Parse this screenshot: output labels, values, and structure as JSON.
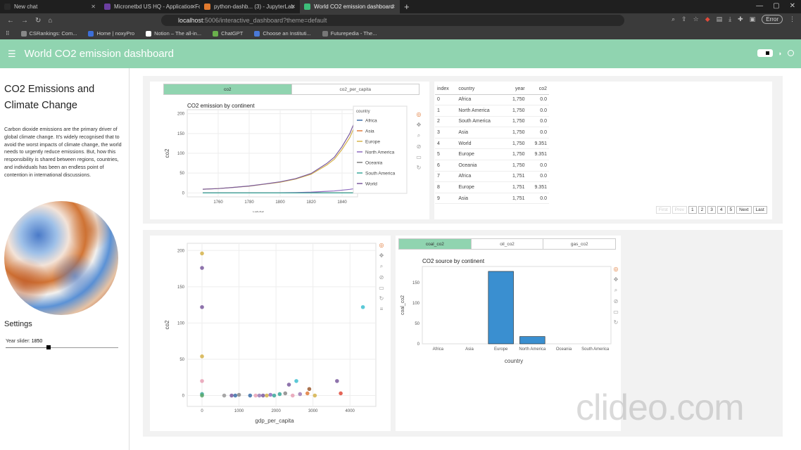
{
  "browser": {
    "tabs": [
      {
        "label": "New chat",
        "color": "#2a2a2a",
        "active": false
      },
      {
        "label": "Micronetbd US HQ - Application Fo",
        "color": "#6b3fa0",
        "active": false
      },
      {
        "label": "python-dashb... (3) - JupyterLab",
        "color": "#e27a2e",
        "active": false
      },
      {
        "label": "World CO2 emission dashboard",
        "color": "#3dbf7a",
        "active": true
      }
    ],
    "url_host": "localhost",
    "url_path": ":5006/interactive_dashboard?theme=default",
    "error_label": "Error",
    "bookmarks": [
      {
        "label": "CSRankings: Com...",
        "color": "#888"
      },
      {
        "label": "Home | noxyPro",
        "color": "#3c6fd8"
      },
      {
        "label": "Notion – The all-in...",
        "color": "#fff"
      },
      {
        "label": "ChatGPT",
        "color": "#6ab04c"
      },
      {
        "label": "Choose an Instituti...",
        "color": "#4a7ad8"
      },
      {
        "label": "Futurepedia - The...",
        "color": "#777"
      }
    ]
  },
  "header": {
    "title": "World CO2 emission dashboard",
    "color": "#90d4b0"
  },
  "sidebar": {
    "title": "CO2 Emissions and Climate Change",
    "text": "Carbon dioxide emissions are the primary driver of global climate change. It’s widely recognised that to avoid the worst impacts of climate change, the world needs to urgently reduce emissions. But, how this responsibility is shared between regions, countries, and individuals has been an endless point of contention in international discussions.",
    "settings_label": "Settings",
    "slider_label": "Year slider:",
    "slider_value": "1850",
    "slider_fraction": 0.38
  },
  "top_tabs": [
    "co2",
    "co2_per_capita"
  ],
  "table": {
    "columns": [
      "index",
      "country",
      "year",
      "co2"
    ],
    "rows": [
      [
        "0",
        "Africa",
        "1,750",
        "0.0"
      ],
      [
        "1",
        "North America",
        "1,750",
        "0.0"
      ],
      [
        "2",
        "South America",
        "1,750",
        "0.0"
      ],
      [
        "3",
        "Asia",
        "1,750",
        "0.0"
      ],
      [
        "4",
        "World",
        "1,750",
        "9.351"
      ],
      [
        "5",
        "Europe",
        "1,750",
        "9.351"
      ],
      [
        "6",
        "Oceania",
        "1,750",
        "0.0"
      ],
      [
        "7",
        "Africa",
        "1,751",
        "0.0"
      ],
      [
        "8",
        "Europe",
        "1,751",
        "9.351"
      ],
      [
        "9",
        "Asia",
        "1,751",
        "0.0"
      ]
    ],
    "pager": [
      "First",
      "Prev",
      "1",
      "2",
      "3",
      "4",
      "5",
      "Next",
      "Last"
    ]
  },
  "bottom_tabs": [
    "coal_co2",
    "oil_co2",
    "gas_co2"
  ],
  "chart_data": [
    {
      "type": "line",
      "title": "CO2 emission by continent",
      "xlabel": "year",
      "ylabel": "co2",
      "xlim": [
        1740,
        1850
      ],
      "ylim": [
        -10,
        210
      ],
      "xticks": [
        1760,
        1780,
        1800,
        1820,
        1840
      ],
      "yticks": [
        0,
        50,
        100,
        150,
        200
      ],
      "legend_title": "country",
      "legend_position": "top-right",
      "x": [
        1750,
        1760,
        1770,
        1780,
        1790,
        1800,
        1810,
        1820,
        1830,
        1835,
        1840,
        1845,
        1850
      ],
      "series": [
        {
          "name": "Africa",
          "color": "#3b6ea8",
          "values": [
            0,
            0,
            0,
            0,
            0,
            0,
            0,
            0,
            0,
            0,
            0,
            0,
            0
          ]
        },
        {
          "name": "Asia",
          "color": "#e07b3a",
          "values": [
            0,
            0,
            0,
            0,
            0,
            0,
            0,
            0,
            0,
            0,
            0,
            0,
            0
          ]
        },
        {
          "name": "Europe",
          "color": "#d5b24a",
          "values": [
            9.351,
            11,
            14,
            17,
            22,
            27,
            35,
            47,
            70,
            85,
            110,
            140,
            185
          ]
        },
        {
          "name": "North America",
          "color": "#8e6bbf",
          "values": [
            0,
            0,
            0,
            0,
            0,
            0.5,
            1,
            2,
            4,
            5,
            7,
            9,
            12
          ]
        },
        {
          "name": "Oceania",
          "color": "#7e7e7e",
          "values": [
            0,
            0,
            0,
            0,
            0,
            0,
            0,
            0,
            0,
            0,
            0,
            0,
            0
          ]
        },
        {
          "name": "South America",
          "color": "#3aa89a",
          "values": [
            0,
            0,
            0,
            0,
            0,
            0,
            0,
            0,
            0,
            0,
            0,
            0,
            0
          ]
        },
        {
          "name": "World",
          "color": "#7a5a9e",
          "values": [
            9.351,
            11,
            14,
            17.5,
            22.5,
            28,
            36,
            49,
            74,
            90,
            117,
            150,
            198
          ]
        }
      ]
    },
    {
      "type": "scatter",
      "title": "",
      "xlabel": "gdp_per_capita",
      "ylabel": "co2",
      "xlim": [
        -400,
        4700
      ],
      "ylim": [
        -15,
        210
      ],
      "xticks": [
        0,
        1000,
        2000,
        3000,
        4000
      ],
      "yticks": [
        0,
        50,
        100,
        150,
        200
      ],
      "points": [
        {
          "x": 0,
          "y": 196,
          "color": "#d5b24a"
        },
        {
          "x": 0,
          "y": 176,
          "color": "#7a5a9e"
        },
        {
          "x": 0,
          "y": 122,
          "color": "#7a5a9e"
        },
        {
          "x": 0,
          "y": 54,
          "color": "#d5b24a"
        },
        {
          "x": 0,
          "y": 20,
          "color": "#e8a0b5"
        },
        {
          "x": 0,
          "y": 2,
          "color": "#3aa89a"
        },
        {
          "x": 0,
          "y": 0,
          "color": "#5aa86a"
        },
        {
          "x": 600,
          "y": 0,
          "color": "#999"
        },
        {
          "x": 800,
          "y": 0,
          "color": "#7a5a9e"
        },
        {
          "x": 900,
          "y": 0,
          "color": "#3b6ea8"
        },
        {
          "x": 1000,
          "y": 1,
          "color": "#888"
        },
        {
          "x": 1300,
          "y": 0,
          "color": "#3b6ea8"
        },
        {
          "x": 1450,
          "y": 0,
          "color": "#e8a0b5"
        },
        {
          "x": 1550,
          "y": 0,
          "color": "#9c7bb5"
        },
        {
          "x": 1650,
          "y": 0,
          "color": "#7a5a9e"
        },
        {
          "x": 1750,
          "y": 0,
          "color": "#d5b24a"
        },
        {
          "x": 1850,
          "y": 1,
          "color": "#8e6bbf"
        },
        {
          "x": 1950,
          "y": 0,
          "color": "#3aa89a"
        },
        {
          "x": 2100,
          "y": 2,
          "color": "#3aa89a"
        },
        {
          "x": 2250,
          "y": 3,
          "color": "#888"
        },
        {
          "x": 2350,
          "y": 15,
          "color": "#7a5a9e"
        },
        {
          "x": 2450,
          "y": 0,
          "color": "#e8a0b5"
        },
        {
          "x": 2550,
          "y": 20,
          "color": "#40c0d0"
        },
        {
          "x": 2650,
          "y": 2,
          "color": "#9c7bb5"
        },
        {
          "x": 2850,
          "y": 3,
          "color": "#e07b3a"
        },
        {
          "x": 2900,
          "y": 9,
          "color": "#9c5a30"
        },
        {
          "x": 3050,
          "y": 0,
          "color": "#d5b24a"
        },
        {
          "x": 3650,
          "y": 20,
          "color": "#7a5a9e"
        },
        {
          "x": 3750,
          "y": 3,
          "color": "#e04a3a"
        },
        {
          "x": 4350,
          "y": 122,
          "color": "#40c0d0"
        }
      ]
    },
    {
      "type": "bar",
      "title": "CO2 source by continent",
      "xlabel": "country",
      "ylabel": "coal_co2",
      "ylim": [
        0,
        190
      ],
      "yticks": [
        0,
        50,
        100,
        150
      ],
      "categories": [
        "Africa",
        "Asia",
        "Europe",
        "North America",
        "Oceania",
        "South America"
      ],
      "values": [
        0,
        0,
        178,
        18,
        0,
        0
      ],
      "color": "#3a8fd0"
    }
  ],
  "watermark": "clideo.com"
}
